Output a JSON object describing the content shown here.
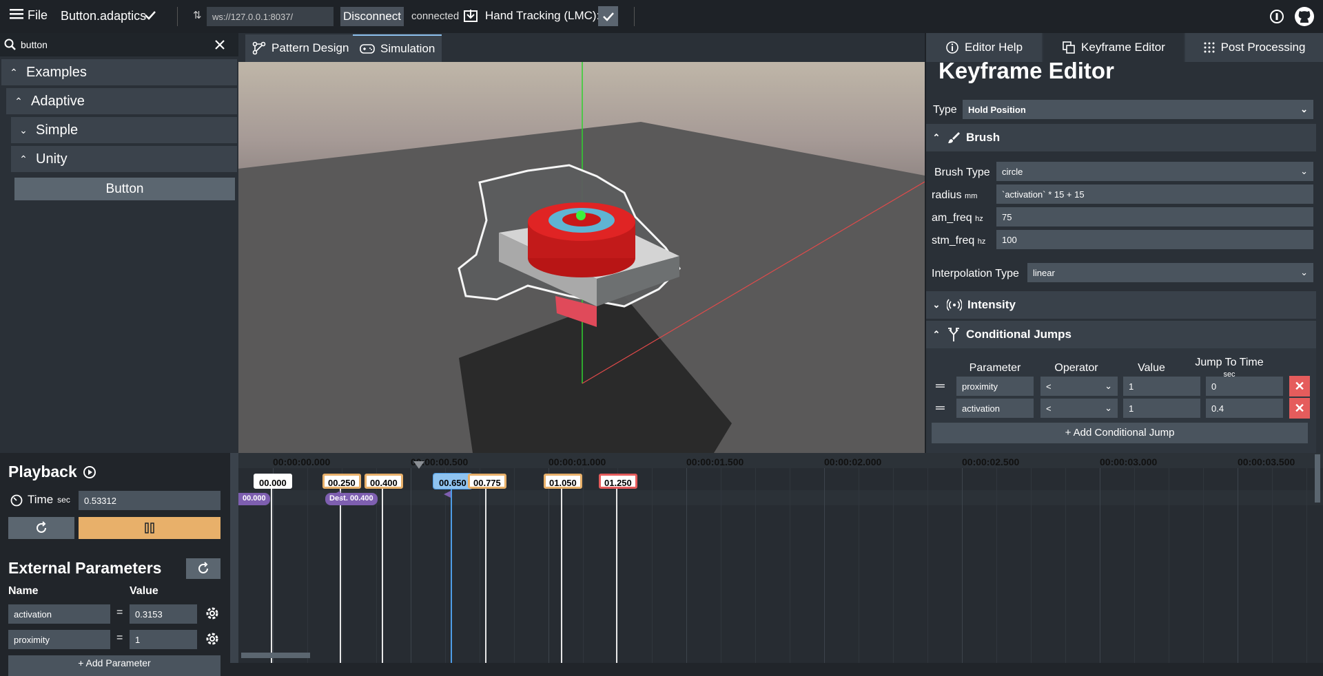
{
  "topbar": {
    "file_label": "File",
    "filename": "Button.adaptics",
    "url": "ws://127.0.0.1:8037/",
    "disconnect_label": "Disconnect",
    "connection_status": "connected",
    "hand_tracking_label": "Hand Tracking (LMC):"
  },
  "left": {
    "search_value": "button",
    "tree": {
      "examples": "Examples",
      "adaptive": "Adaptive",
      "simple": "Simple",
      "unity": "Unity",
      "button": "Button"
    }
  },
  "center_tabs": {
    "pattern_design": "Pattern Design",
    "simulation": "Simulation"
  },
  "right": {
    "tabs": {
      "editor_help": "Editor Help",
      "keyframe_editor": "Keyframe Editor",
      "post_processing": "Post Processing"
    },
    "title": "Keyframe Editor",
    "type_label": "Type",
    "type_value": "Hold Position",
    "brush_section": "Brush",
    "brush_type_label": "Brush Type",
    "brush_type_value": "circle",
    "radius_label": "radius",
    "radius_unit": "mm",
    "radius_value": "`activation` * 15 + 15",
    "am_freq_label": "am_freq",
    "am_freq_unit": "hz",
    "am_freq_value": "75",
    "stm_freq_label": "stm_freq",
    "stm_freq_unit": "hz",
    "stm_freq_value": "100",
    "interp_label": "Interpolation Type",
    "interp_value": "linear",
    "intensity_section": "Intensity",
    "cj_section": "Conditional Jumps",
    "cj_headers": {
      "parameter": "Parameter",
      "operator": "Operator",
      "value": "Value",
      "jump_to_time": "Jump To Time",
      "jump_unit": "sec"
    },
    "cj_rows": [
      {
        "parameter": "proximity",
        "operator": "<",
        "value": "1",
        "jump": "0"
      },
      {
        "parameter": "activation",
        "operator": "<",
        "value": "1",
        "jump": "0.4"
      }
    ],
    "add_cj_label": "+ Add Conditional Jump"
  },
  "playback": {
    "title": "Playback",
    "time_label": "Time",
    "time_unit": "sec",
    "time_value": "0.53312",
    "ext_title": "External Parameters",
    "name_header": "Name",
    "value_header": "Value",
    "params": [
      {
        "name": "activation",
        "value": "0.3153"
      },
      {
        "name": "proximity",
        "value": "1"
      }
    ],
    "add_param_label": "+ Add Parameter"
  },
  "timeline": {
    "ticks": [
      "00:00:00.000",
      "00:00:00.500",
      "00:00:01.000",
      "00:00:01.500",
      "00:00:02.000",
      "00:00:02.500",
      "00:00:03.000",
      "00:00:03.500"
    ],
    "keyframes": [
      "00.000",
      "00.250",
      "00.400",
      "00.650",
      "00.775",
      "01.050",
      "01.250"
    ],
    "jump_markers": [
      "00.000",
      "Dest. 00.400"
    ]
  },
  "colors": {
    "accent_orange": "#e8b06a",
    "delete_red": "#e55c5c",
    "jump_purple": "#7e5fb0",
    "playhead_blue": "#4e9ee8"
  }
}
